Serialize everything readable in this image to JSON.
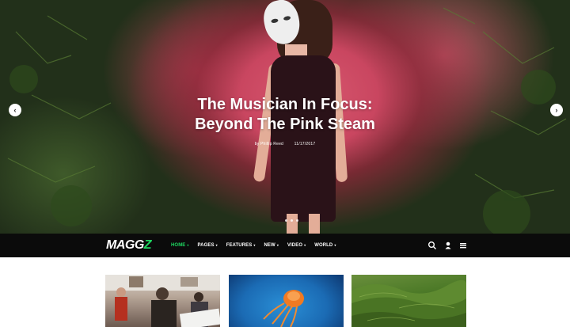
{
  "hero": {
    "title_line1": "The Musician In Focus:",
    "title_line2": "Beyond The Pink Steam",
    "author": "by Phillip Reed",
    "date": "11/17/2017",
    "prev_icon": "chevron-left-icon",
    "next_icon": "chevron-right-icon",
    "slide_count": 3
  },
  "nav": {
    "logo_main": "MAGG",
    "logo_accent": "Z",
    "accent_color": "#1ed760",
    "items": [
      {
        "label": "HOME",
        "active": true
      },
      {
        "label": "PAGES",
        "active": false
      },
      {
        "label": "FEATURES",
        "active": false
      },
      {
        "label": "NEW",
        "active": false
      },
      {
        "label": "VIDEO",
        "active": false
      },
      {
        "label": "WORLD",
        "active": false
      }
    ],
    "caret": "▾",
    "icons": [
      "search-icon",
      "user-icon",
      "menu-icon"
    ]
  },
  "cards": [
    {
      "image": "office-workers-photo"
    },
    {
      "image": "jellyfish-photo"
    },
    {
      "image": "green-hills-photo"
    }
  ]
}
